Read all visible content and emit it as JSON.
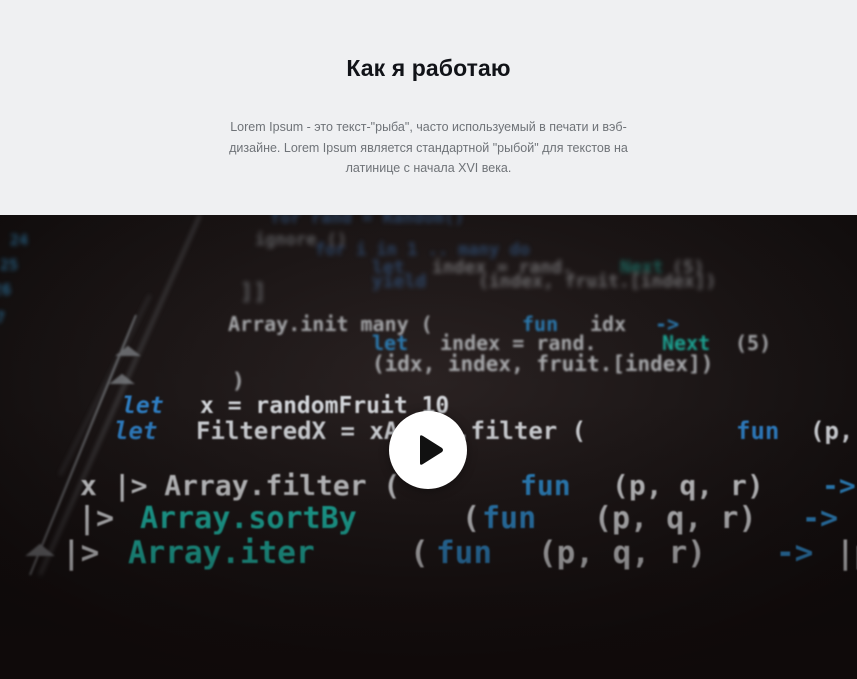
{
  "section": {
    "title": "Как я работаю",
    "description": "Lorem Ipsum - это текст-\"рыба\", часто используемый в печати и вэб-дизайне. Lorem Ipsum является стандартной \"рыбой\" для текстов на латинице с начала XVI века."
  },
  "video": {
    "play_icon": "play-icon",
    "code_lines": [
      "Array.init many (fun idx ->",
      "let index = rand.Next(5)",
      "(idx, index, fruit.[index])",
      ")",
      "let x = randomFruit 10",
      "let FilteredX = xArray.filter (fun (p,",
      "x |> Array.filter (fun (p, q, r) ->",
      "|> Array.sortBy (fun (p, q, r) ->",
      "|> Array.iter (fun (p, q, r) ->|p"
    ],
    "colors": {
      "keyword": "#3fa2d6",
      "accent": "#22c7b4",
      "text": "#c9ccd0",
      "background": "#0d0a0a"
    }
  }
}
